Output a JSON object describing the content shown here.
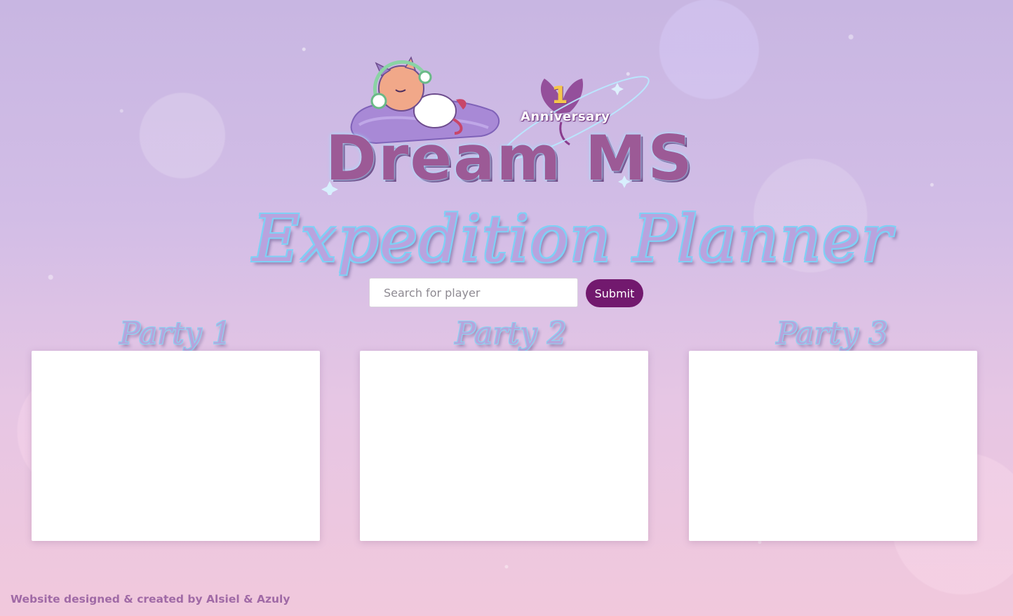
{
  "logo": {
    "wordmark": "Dream MS",
    "anniversary_number": "1",
    "anniversary_label": "Anniversary"
  },
  "title": "Expedition Planner",
  "search": {
    "placeholder": "Search for player",
    "value": "",
    "submit_label": "Submit"
  },
  "parties": [
    {
      "label": "Party 1"
    },
    {
      "label": "Party 2"
    },
    {
      "label": "Party 3"
    }
  ],
  "footer": {
    "credit": "Website designed & created by Alsiel & Azuly"
  },
  "colors": {
    "submit_button": "#72196e",
    "footer_text": "#a06aa6",
    "wordmark": "#9c5a96",
    "title_outline": "#7fd0f5"
  }
}
